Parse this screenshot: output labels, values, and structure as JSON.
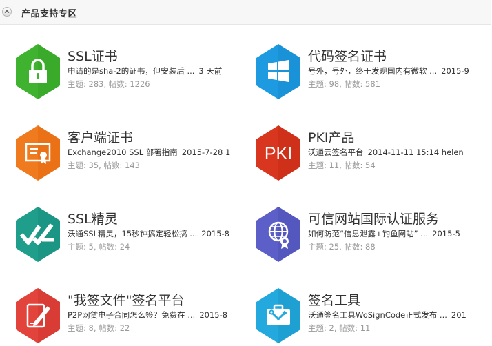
{
  "section": {
    "title": "产品支持专区"
  },
  "colors": {
    "ssl": "#3fb32f",
    "code_signing": "#1e9be0",
    "client": "#f07a1e",
    "pki": "#d9361f",
    "ssl_wizard": "#1f9e8c",
    "trusted_site": "#5b5fc7",
    "sign_doc": "#e2443c",
    "sign_tool": "#23a9dd"
  },
  "forums": [
    {
      "title": "SSL证书",
      "icon": "lock-icon",
      "latest": "申请的是sha-2的证书，但安装后 ...",
      "time": "3 天前",
      "stats_topics_label": "主题: ",
      "topics": "283",
      "stats_posts_label": ", 帖数: ",
      "posts": "1226"
    },
    {
      "title": "代码签名证书",
      "icon": "windows-icon",
      "latest": "号外，号外，终于发现国内有微软 ...",
      "time": "2015-9",
      "stats_topics_label": "主题: ",
      "topics": "98",
      "stats_posts_label": ", 帖数: ",
      "posts": "581"
    },
    {
      "title": "客户端证书",
      "icon": "certificate-icon",
      "latest": "Exchange2010 SSL 部署指南",
      "time": "2015-7-28 1",
      "stats_topics_label": "主题: ",
      "topics": "35",
      "stats_posts_label": ", 帖数: ",
      "posts": "143"
    },
    {
      "title": "PKI产品",
      "icon": "pki-icon",
      "icon_text": "PKI",
      "latest": "沃通云签名平台",
      "time": "2014-11-11 15:14 helen",
      "stats_topics_label": "主题: ",
      "topics": "11",
      "stats_posts_label": ", 帖数: ",
      "posts": "54"
    },
    {
      "title": "SSL精灵",
      "icon": "double-check-icon",
      "latest": "沃通SSL精灵，15秒钟搞定轻松搞 ...",
      "time": "2015-8",
      "stats_topics_label": "主题: ",
      "topics": "5",
      "stats_posts_label": ", 帖数: ",
      "posts": "24"
    },
    {
      "title": "可信网站国际认证服务",
      "icon": "globe-seal-icon",
      "latest": "如何防范“信息泄露+钓鱼网站” ...",
      "time": "2015-5",
      "stats_topics_label": "主题: ",
      "topics": "25",
      "stats_posts_label": ", 帖数: ",
      "posts": "88"
    },
    {
      "title": "\"我签文件\"签名平台",
      "icon": "pen-document-icon",
      "latest": "P2P网贷电子合同怎么签？免费在 ...",
      "time": "2015-8",
      "stats_topics_label": "主题: ",
      "topics": "8",
      "stats_posts_label": ", 帖数: ",
      "posts": "22"
    },
    {
      "title": "签名工具",
      "icon": "toolbox-icon",
      "latest": "沃通签名工具WoSignCode正式发布 ...",
      "time": "201",
      "stats_topics_label": "主题: ",
      "topics": "2",
      "stats_posts_label": ", 帖数: ",
      "posts": "11"
    }
  ]
}
